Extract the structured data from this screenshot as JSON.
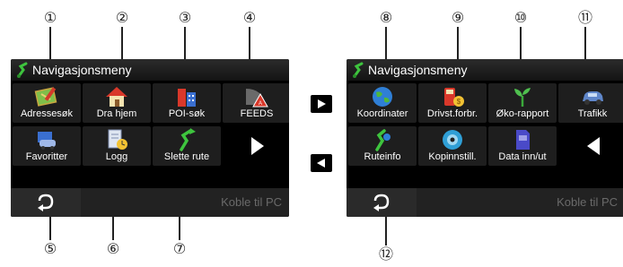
{
  "callouts": {
    "c1": "①",
    "c2": "②",
    "c3": "③",
    "c4": "④",
    "c5": "⑤",
    "c6": "⑥",
    "c7": "⑦",
    "c8": "⑧",
    "c9": "⑨",
    "c10": "⑩",
    "c11": "⑪",
    "c12": "⑫"
  },
  "left_screen": {
    "title": "Navigasjonsmeny",
    "tiles": [
      "Adressesøk",
      "Dra hjem",
      "POI-søk",
      "FEEDS",
      "Favoritter",
      "Logg",
      "Slette rute"
    ],
    "next_arrow": "next-page",
    "connect_pc": "Koble til PC"
  },
  "right_screen": {
    "title": "Navigasjonsmeny",
    "tiles": [
      "Koordinater",
      "Drivst.forbr.",
      "Øko-rapport",
      "Trafikk",
      "Ruteinfo",
      "Kopinnstill.",
      "Data inn/ut"
    ],
    "prev_arrow": "previous-page",
    "connect_pc": "Koble til PC"
  },
  "colors": {
    "screen_bg": "#000000",
    "tile_bg": "#1e1e1e",
    "text": "#ffffff",
    "disabled_text": "#6a6a6a"
  }
}
